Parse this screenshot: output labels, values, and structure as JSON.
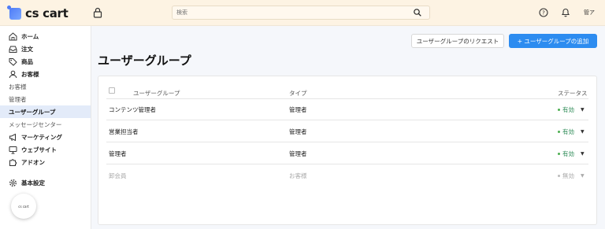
{
  "app": {
    "name": "cs cart"
  },
  "header": {
    "search_placeholder": "検索",
    "user_label": "管ア"
  },
  "sidebar": {
    "items": [
      {
        "label": "ホーム",
        "icon": "home-icon"
      },
      {
        "label": "注文",
        "icon": "inbox-icon"
      },
      {
        "label": "商品",
        "icon": "tag-icon"
      },
      {
        "label": "お客様",
        "icon": "user-icon"
      },
      {
        "label": "お客様"
      },
      {
        "label": "管理者"
      },
      {
        "label": "ユーザーグループ"
      },
      {
        "label": "メッセージセンター"
      },
      {
        "label": "マーケティング",
        "icon": "megaphone-icon"
      },
      {
        "label": "ウェブサイト",
        "icon": "monitor-icon"
      },
      {
        "label": "アドオン",
        "icon": "puzzle-icon"
      },
      {
        "label": "基本設定",
        "icon": "gear-icon"
      }
    ],
    "mini_logo": "cs cart"
  },
  "toolbar": {
    "request_label": "ユーザーグループのリクエスト",
    "add_label": "+ ユーザーグループの追加"
  },
  "page": {
    "title": "ユーザーグループ"
  },
  "table": {
    "headers": [
      "ユーザーグループ",
      "タイプ",
      "ステータス"
    ],
    "rows": [
      {
        "name": "コンテンツ管理者",
        "type": "管理者",
        "status": "有効",
        "disabled": false
      },
      {
        "name": "営業担当者",
        "type": "管理者",
        "status": "有効",
        "disabled": false
      },
      {
        "name": "管理者",
        "type": "管理者",
        "status": "有効",
        "disabled": false
      },
      {
        "name": "卸会員",
        "type": "お客様",
        "status": "無効",
        "disabled": true
      }
    ]
  },
  "colors": {
    "accent": "#2d8cf0",
    "topbar": "#fdf3e3",
    "active_status": "#2e8b57"
  }
}
